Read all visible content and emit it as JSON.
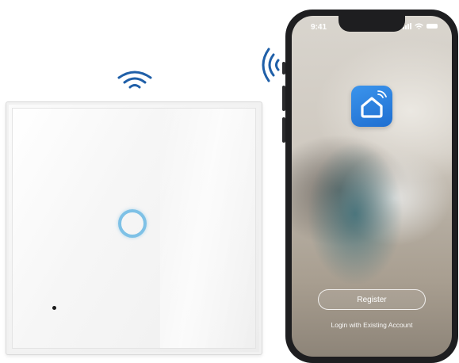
{
  "phone": {
    "status_time": "9:41",
    "register_label": "Register",
    "login_label": "Login with Existing Account"
  },
  "icons": {
    "wifi_top": "wifi-icon",
    "wifi_side": "wifi-icon",
    "app_icon": "smart-home-app-icon",
    "status_signal": "signal-bars-icon",
    "status_wifi": "wifi-icon",
    "status_battery": "battery-icon"
  },
  "colors": {
    "touch_ring": "#7ec1e6",
    "app_icon_blue": "#2a80df",
    "wifi_blue": "#1f5fa8",
    "phone_frame": "#1e1e20"
  }
}
